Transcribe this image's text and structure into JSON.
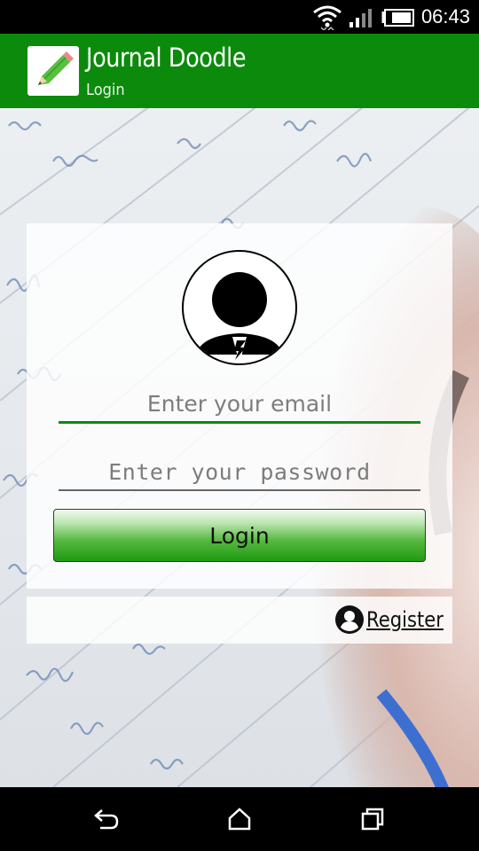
{
  "status_bar": {
    "time": "06:43",
    "wifi_icon": "wifi-icon",
    "signal_icon": "signal-icon",
    "battery_icon": "battery-icon"
  },
  "action_bar": {
    "title": "Journal Doodle",
    "subtitle": "Login",
    "app_icon": "pencil-icon"
  },
  "login_form": {
    "avatar_icon": "user-avatar-icon",
    "email": {
      "value": "",
      "placeholder": "Enter your email"
    },
    "password": {
      "value": "",
      "placeholder": "Enter your password"
    },
    "login_label": "Login"
  },
  "register": {
    "icon": "account-circle-icon",
    "label": "Register"
  },
  "nav_bar": {
    "back_icon": "back-icon",
    "home_icon": "home-icon",
    "recents_icon": "recents-icon"
  },
  "colors": {
    "accent": "#0c8a0c",
    "login_gradient_top": "#f2faf0",
    "login_gradient_bottom": "#1f9a12"
  }
}
